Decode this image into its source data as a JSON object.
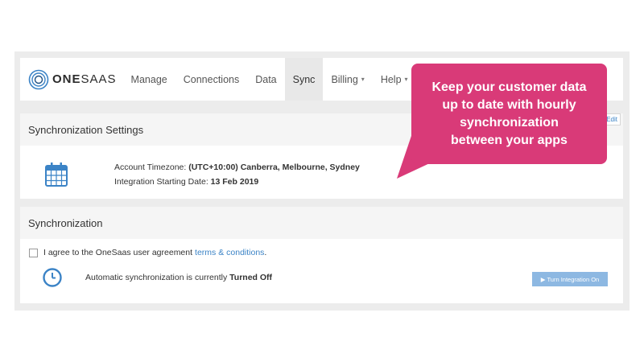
{
  "brand": {
    "name_bold": "ONE",
    "name_rest": "SAAS"
  },
  "nav": {
    "items": [
      {
        "label": "Manage",
        "caret": ""
      },
      {
        "label": "Connections",
        "caret": ""
      },
      {
        "label": "Data",
        "caret": ""
      },
      {
        "label": "Sync",
        "caret": "",
        "active": true
      },
      {
        "label": "Billing",
        "caret": "▾"
      },
      {
        "label": "Help",
        "caret": "▾"
      }
    ]
  },
  "settings_panel": {
    "title": "Synchronization Settings",
    "edit_label": "Edit",
    "timezone_label": "Account Timezone:",
    "timezone_value": "(UTC+10:00) Canberra, Melbourne, Sydney",
    "start_label": "Integration Starting Date:",
    "start_value": "13 Feb 2019"
  },
  "sync_panel": {
    "title": "Synchronization",
    "agree_text": "I agree to the OneSaas user agreement",
    "terms_link": "terms & conditions",
    "agree_end": ".",
    "auto_text": "Automatic synchronization is currently",
    "auto_status": "Turned Off",
    "turn_on_button": "▶ Turn Integration On"
  },
  "callout": {
    "lines": [
      "Keep your customer data",
      "up to date with hourly",
      "synchronization",
      "between your apps"
    ]
  },
  "colors": {
    "accent_pink": "#d93a78",
    "link_blue": "#3b83c6",
    "icon_blue": "#3b83c6",
    "button_blue": "#8db8e2"
  }
}
